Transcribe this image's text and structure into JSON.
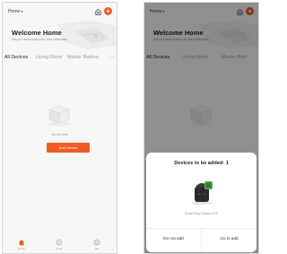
{
  "colors": {
    "accent": "#f05a24",
    "background": "#f7f7f7"
  },
  "home_screen": {
    "home_selector": "Home",
    "welcome_title": "Welcome Home",
    "welcome_subtitle": "Set your home location for more information",
    "tabs": [
      "All Devices",
      "Living Room",
      "Master Bedroo"
    ],
    "more_icon": "ellipsis-icon",
    "empty_text": "No devices",
    "add_device_label": "Add Device",
    "nav": [
      {
        "label": "Home",
        "icon": "home-icon"
      },
      {
        "label": "Smart",
        "icon": "smart-icon"
      },
      {
        "label": "Me",
        "icon": "profile-icon"
      }
    ]
  },
  "add_screen": {
    "home_selector": "Home",
    "welcome_title": "Welcome Home",
    "welcome_subtitle": "Set your home location for more information",
    "tabs": [
      "All Devices",
      "Living Room",
      "Master Bedr"
    ],
    "nav": [
      {
        "label": "Home"
      },
      {
        "label": "Smart"
      },
      {
        "label": "Me"
      }
    ],
    "dialog": {
      "title": "Devices to be added: 1",
      "device_name": "Smart Plug Outdoor 2CE",
      "cancel_label": "Do not add",
      "confirm_label": "Go to add"
    }
  }
}
